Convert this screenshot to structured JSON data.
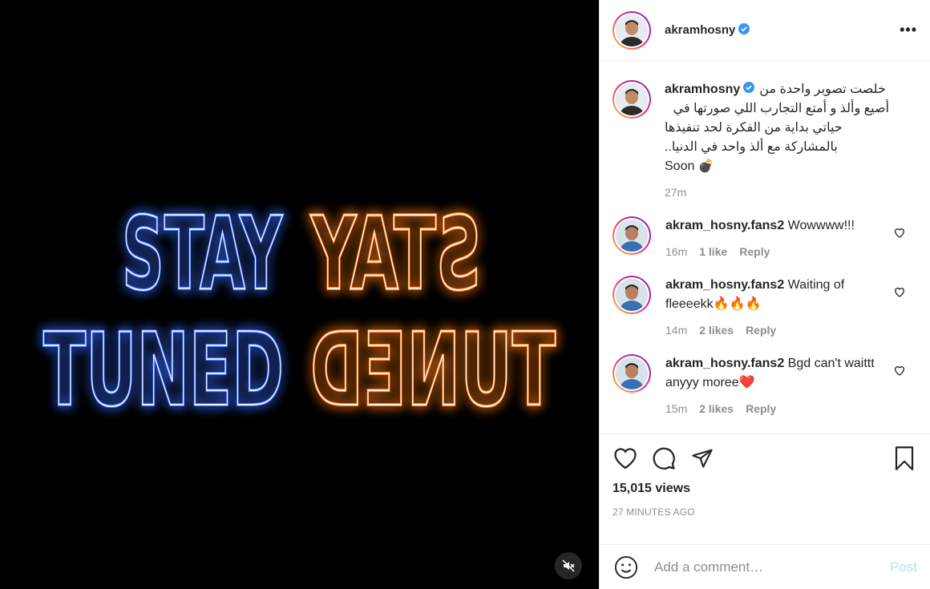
{
  "media": {
    "neon_line1_left": "STAY",
    "neon_line1_right": "STAY",
    "neon_line2_left": "TUNED",
    "neon_line2_right": "TUNED",
    "colors": {
      "blue_neon": "#2f6bff",
      "orange_neon": "#ff7a1a",
      "background": "#000000"
    },
    "mute_icon": "speaker-muted-icon"
  },
  "header": {
    "username": "akramhosny",
    "verified_icon": "verified-badge-icon",
    "more_icon": "more-options-icon",
    "more_label": "•••"
  },
  "caption": {
    "username": "akramhosny",
    "line1": "خلصت تصوير واحدة من",
    "line2": "أصيع وألذ و أمتع التجارب اللي صورتها في",
    "line3": "حياتي بداية من الفكرة لحد تنفيذها",
    "line4": "بالمشاركة مع ألذ واحد في الدنيا..",
    "line5": "Soon 💣",
    "time": "27m"
  },
  "comments": [
    {
      "username": "akram_hosny.fans2",
      "text": "Wowwww!!!",
      "time": "16m",
      "likes": "1 like",
      "reply": "Reply"
    },
    {
      "username": "akram_hosny.fans2",
      "text": "Waiting of fleeeekk🔥🔥🔥",
      "time": "14m",
      "likes": "2 likes",
      "reply": "Reply"
    },
    {
      "username": "akram_hosny.fans2",
      "text": "Bgd can't waittt anyyy moree❤️",
      "time": "15m",
      "likes": "2 likes",
      "reply": "Reply"
    }
  ],
  "actions": {
    "icons": [
      "heart-icon",
      "comment-icon",
      "share-icon",
      "bookmark-icon"
    ],
    "views": "15,015 views",
    "posted": "27 MINUTES AGO"
  },
  "add_comment": {
    "placeholder": "Add a comment…",
    "post_label": "Post",
    "emoji_icon": "emoji-icon"
  }
}
